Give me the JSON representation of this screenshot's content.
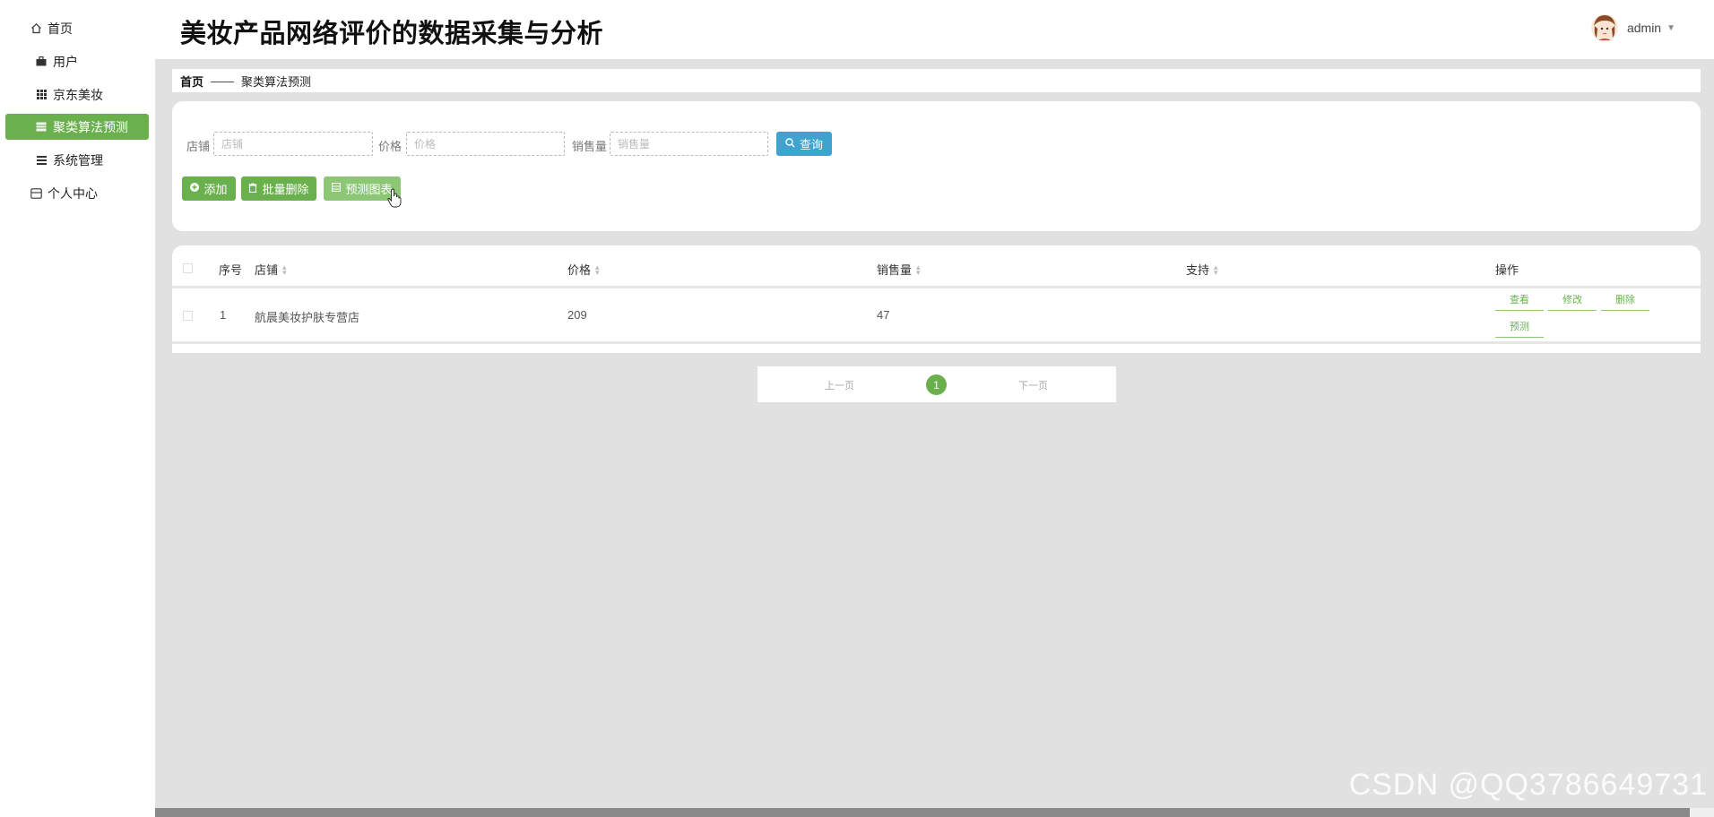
{
  "app": {
    "title": "美妆产品网络评价的数据采集与分析"
  },
  "user": {
    "name": "admin"
  },
  "sidebar": {
    "items": [
      {
        "label": "首页",
        "icon": "home-icon"
      },
      {
        "label": "用户",
        "icon": "briefcase-icon"
      },
      {
        "label": "京东美妆",
        "icon": "grid-icon"
      },
      {
        "label": "聚类算法预测",
        "icon": "table-icon",
        "active": true
      },
      {
        "label": "系统管理",
        "icon": "list-icon"
      },
      {
        "label": "个人中心",
        "icon": "window-icon"
      }
    ]
  },
  "breadcrumb": {
    "home": "首页",
    "separator": "——",
    "current": "聚类算法预测"
  },
  "search": {
    "shop_label": "店铺",
    "shop_placeholder": "店铺",
    "price_label": "价格",
    "price_placeholder": "价格",
    "sales_label": "销售量",
    "sales_placeholder": "销售量",
    "query_label": "查询"
  },
  "actions": {
    "add": "添加",
    "batch_delete": "批量删除",
    "chart": "预测图表"
  },
  "table": {
    "headers": {
      "index": "序号",
      "shop": "店铺",
      "price": "价格",
      "sales": "销售量",
      "support": "支持",
      "ops": "操作"
    },
    "rows": [
      {
        "index": "1",
        "shop": "航晨美妆护肤专营店",
        "price": "209",
        "sales": "47",
        "support": ""
      }
    ],
    "row_ops": {
      "view": "查看",
      "edit": "修改",
      "delete": "删除",
      "predict": "预测"
    }
  },
  "pagination": {
    "prev": "上一页",
    "current": "1",
    "next": "下一页"
  },
  "watermark": "CSDN @QQ3786649731",
  "colors": {
    "accent": "#6ab14d",
    "query": "#3fa3cf"
  }
}
